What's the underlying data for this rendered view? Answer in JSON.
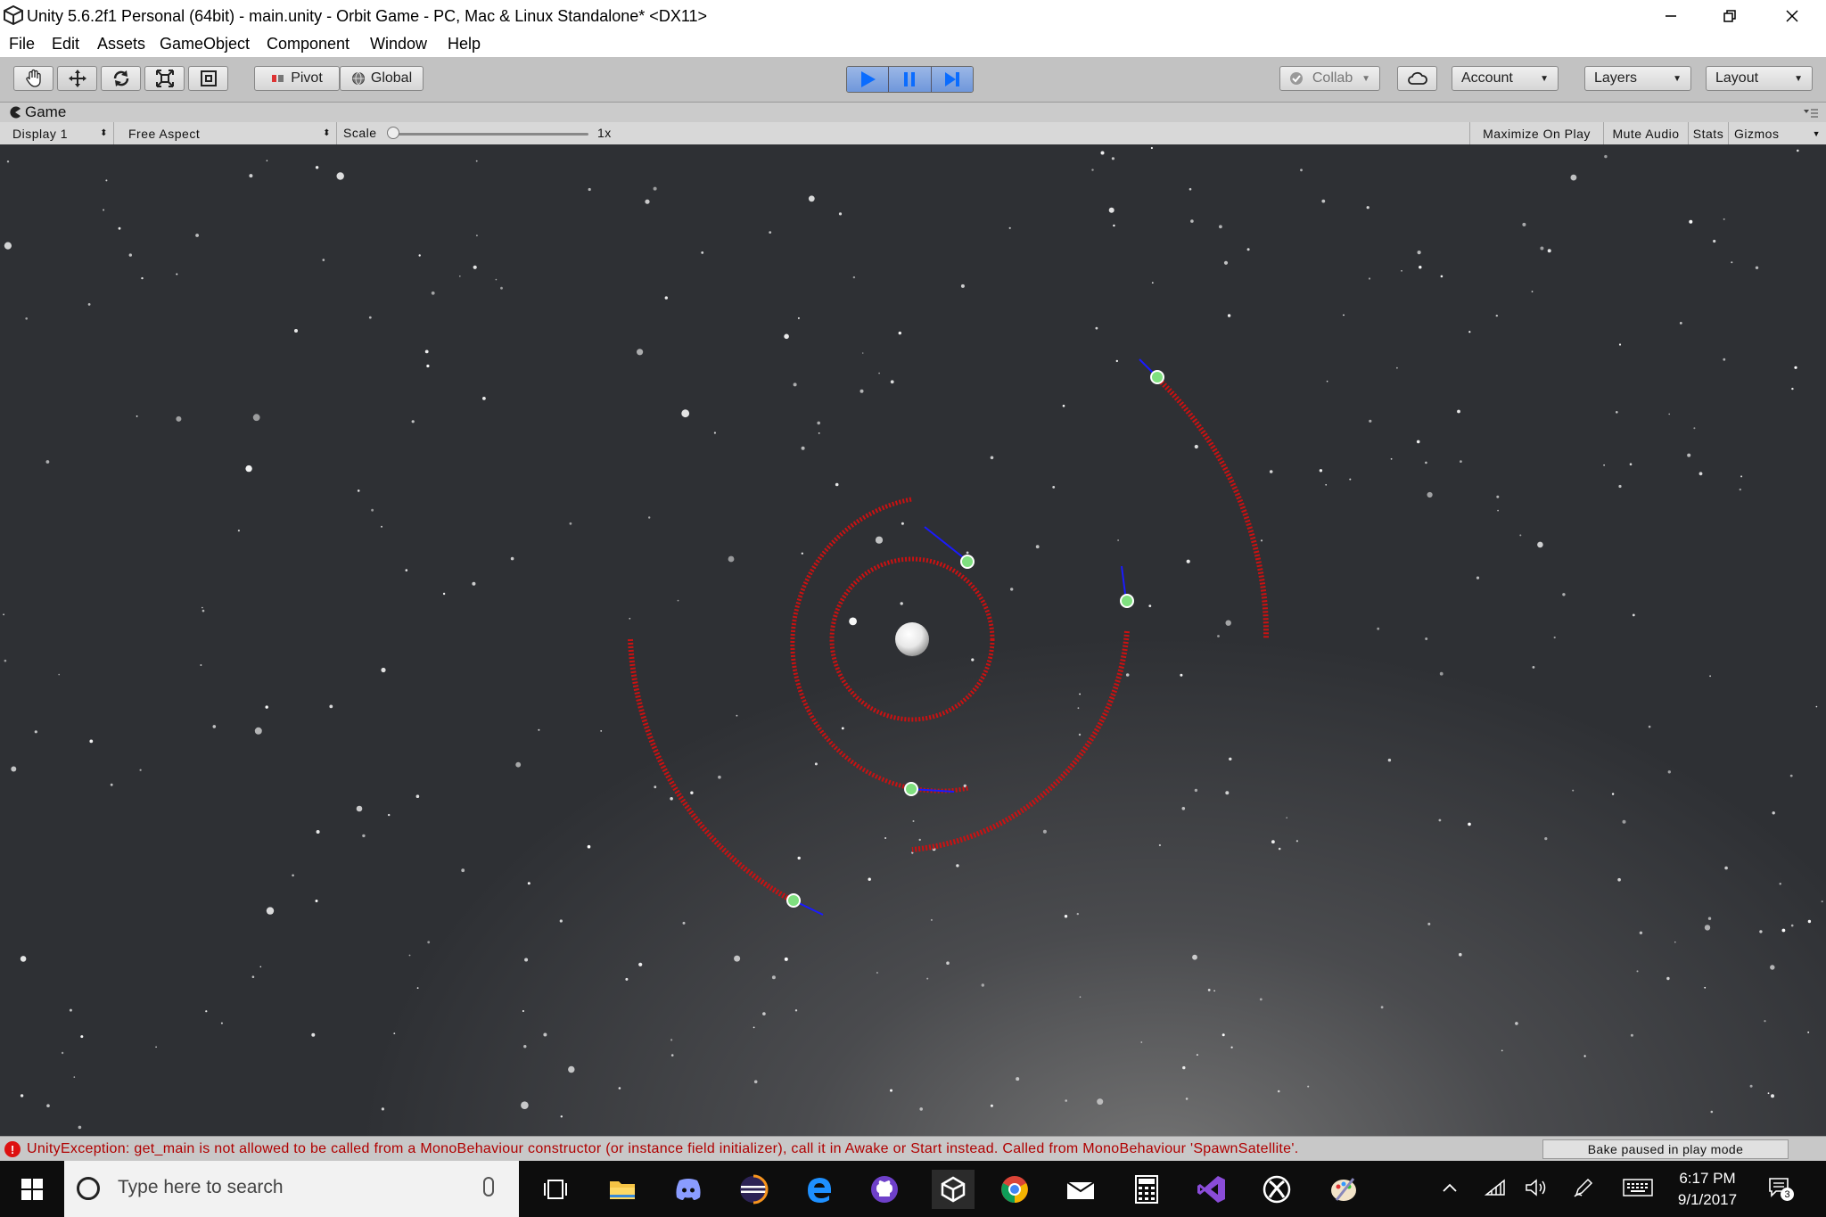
{
  "window": {
    "title": "Unity 5.6.2f1 Personal (64bit) - main.unity - Orbit Game - PC, Mac & Linux Standalone* <DX11>"
  },
  "menu": {
    "items": [
      "File",
      "Edit",
      "Assets",
      "GameObject",
      "Component",
      "Window",
      "Help"
    ]
  },
  "toolbar": {
    "pivot_label": "Pivot",
    "global_label": "Global",
    "collab_label": "Collab",
    "account_label": "Account",
    "layers_label": "Layers",
    "layout_label": "Layout"
  },
  "game_panel": {
    "tab_label": "Game",
    "display_label": "Display 1",
    "aspect_label": "Free Aspect",
    "scale_label": "Scale",
    "scale_value": "1x",
    "maximize_label": "Maximize On Play",
    "mute_label": "Mute Audio",
    "stats_label": "Stats",
    "gizmos_label": "Gizmos"
  },
  "status": {
    "error_message": "UnityException: get_main is not allowed to be called from a MonoBehaviour constructor (or instance field initializer), call it in Awake or Start instead. Called from MonoBehaviour 'SpawnSatellite'.",
    "bake_status": "Bake paused in play mode"
  },
  "taskbar": {
    "search_placeholder": "Type here to search",
    "time": "6:17 PM",
    "date": "9/1/2017",
    "notification_count": "3"
  },
  "colors": {
    "orbit_trail": "#cc1111",
    "velocity_line": "#1a1aff",
    "satellite": "#7fe07f",
    "play_active": "#6f97db"
  }
}
